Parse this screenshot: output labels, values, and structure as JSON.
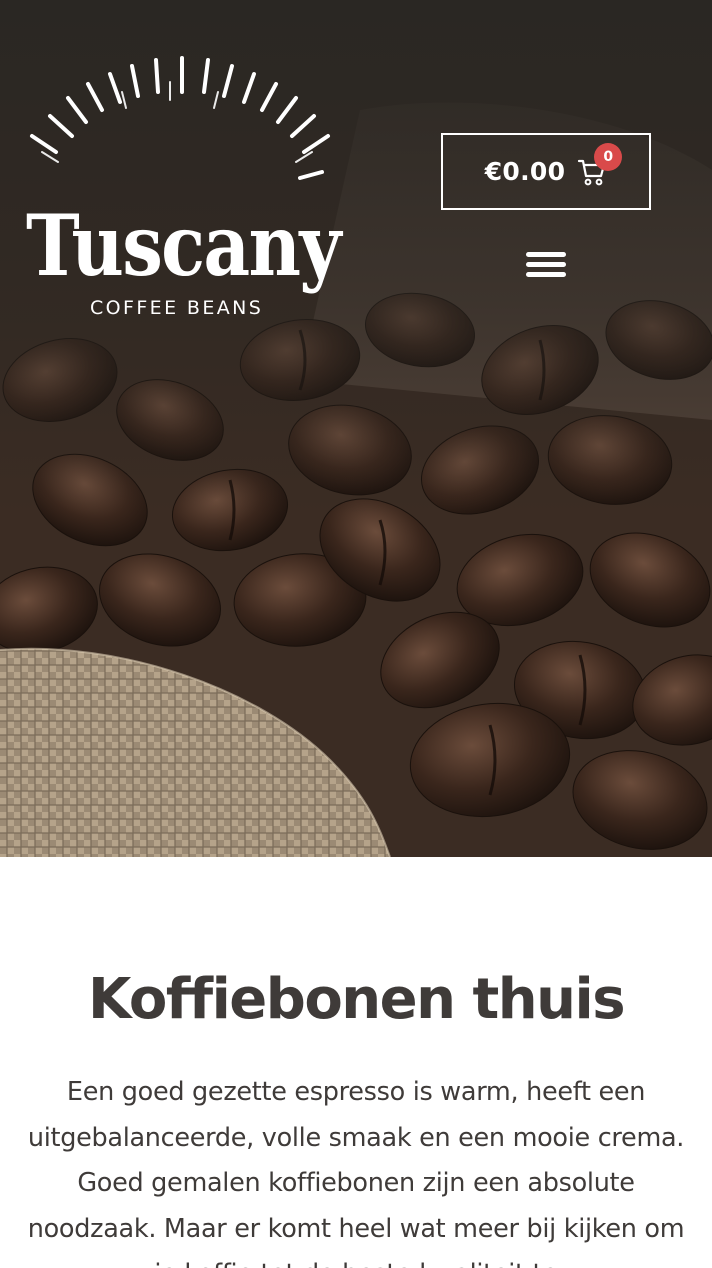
{
  "header": {
    "logo": {
      "name": "Tuscany",
      "tagline": "COFFEE BEANS"
    },
    "cart": {
      "amount": "€0.00",
      "count": "0",
      "icon": "cart-icon"
    },
    "menu_icon": "hamburger-menu-icon"
  },
  "hero": {
    "image": "coffee-beans-on-burlap-photo"
  },
  "main": {
    "title": "Koffiebonen thuis",
    "intro": "Een goed gezette espresso is warm, heeft een uitgebalanceerde, volle smaak en een mooie crema. Goed gemalen koffiebonen zijn een absolute noodzaak. Maar er komt heel wat meer bij kijken om je koffie tot de beste kwaliteit te"
  },
  "colors": {
    "text": "#3f3b39",
    "badge": "#d94a4a",
    "header_text": "#ffffff",
    "background": "#ffffff"
  }
}
